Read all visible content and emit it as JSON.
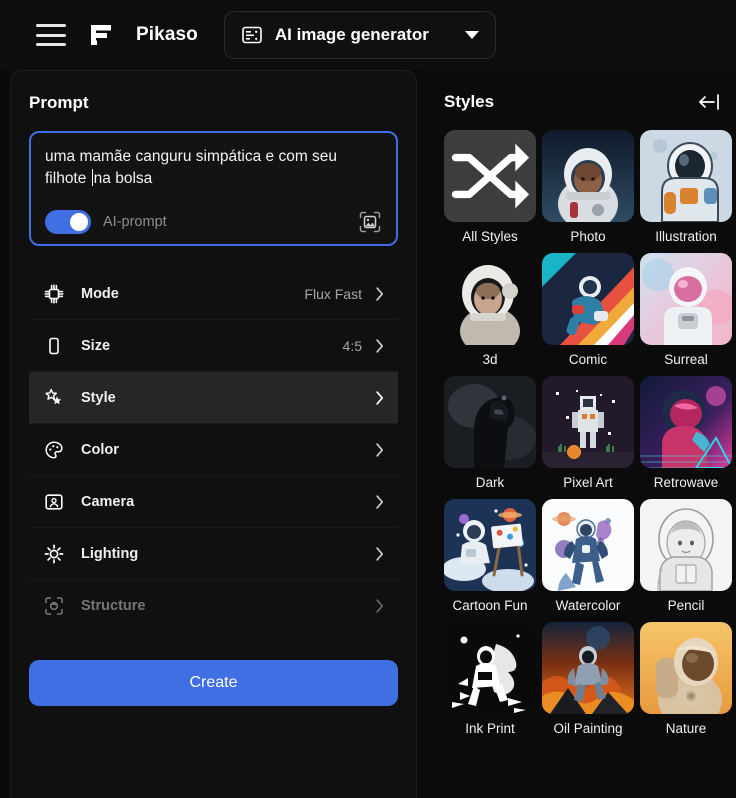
{
  "header": {
    "menu_icon": "hamburger-menu-icon",
    "logo_icon": "freepik-f-logo-icon",
    "brand": "Pikaso",
    "tool_selector": {
      "icon": "ai-image-generator-icon",
      "label": "AI image generator",
      "caret": "chevron-down-icon"
    }
  },
  "prompt_panel": {
    "title": "Prompt",
    "prompt_text_before_caret": "uma mamãe canguru simpática e com seu filhote ",
    "prompt_text_after_caret": "na bolsa",
    "prompt_full_text": "uma mamãe canguru simpática e com seu filhote na bolsa",
    "ai_prompt_toggle": {
      "label": "AI-prompt",
      "state": "on"
    },
    "image_upload_icon": "image-frame-upload-icon",
    "settings": [
      {
        "icon": "mode-gear-icon",
        "label": "Mode",
        "value": "Flux Fast",
        "state": "default"
      },
      {
        "icon": "size-rectangle-icon",
        "label": "Size",
        "value": "4:5",
        "state": "default"
      },
      {
        "icon": "style-stars-icon",
        "label": "Style",
        "value": "",
        "state": "active"
      },
      {
        "icon": "color-palette-icon",
        "label": "Color",
        "value": "",
        "state": "default"
      },
      {
        "icon": "camera-portrait-icon",
        "label": "Camera",
        "value": "",
        "state": "default"
      },
      {
        "icon": "lighting-sun-icon",
        "label": "Lighting",
        "value": "",
        "state": "default"
      },
      {
        "icon": "structure-icon",
        "label": "Structure",
        "value": "",
        "state": "disabled"
      }
    ],
    "create_label": "Create"
  },
  "styles_panel": {
    "title": "Styles",
    "collapse_icon": "collapse-panel-left-arrow-icon",
    "items": [
      {
        "label": "All Styles",
        "thumb": "shuffle-icon-tile"
      },
      {
        "label": "Photo",
        "thumb": "astronaut-photo"
      },
      {
        "label": "Illustration",
        "thumb": "astronaut-illustration"
      },
      {
        "label": "3d",
        "thumb": "astronaut-3d"
      },
      {
        "label": "Comic",
        "thumb": "astronaut-comic"
      },
      {
        "label": "Surreal",
        "thumb": "astronaut-surreal"
      },
      {
        "label": "Dark",
        "thumb": "astronaut-dark"
      },
      {
        "label": "Pixel Art",
        "thumb": "astronaut-pixel-art"
      },
      {
        "label": "Retrowave",
        "thumb": "astronaut-retrowave"
      },
      {
        "label": "Cartoon Fun",
        "thumb": "astronaut-cartoon-fun"
      },
      {
        "label": "Watercolor",
        "thumb": "astronaut-watercolor"
      },
      {
        "label": "Pencil",
        "thumb": "astronaut-pencil"
      },
      {
        "label": "Ink Print",
        "thumb": "astronaut-ink-print"
      },
      {
        "label": "Oil Painting",
        "thumb": "astronaut-oil-painting"
      },
      {
        "label": "Nature",
        "thumb": "astronaut-nature"
      }
    ]
  },
  "colors": {
    "accent": "#3f6fe3",
    "background": "#0a0a0a",
    "panel": "#101010",
    "row_active": "#262626",
    "text": "#ffffff",
    "muted_text": "#8e8e8e"
  }
}
